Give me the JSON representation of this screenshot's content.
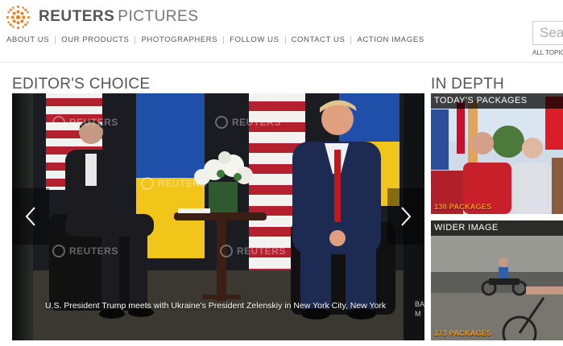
{
  "header": {
    "brand_bold": "REUTERS",
    "brand_light": "PICTURES",
    "logo_icon": "reuters-logo-icon",
    "accent_color": "#f07f1a"
  },
  "nav": {
    "items": [
      {
        "label": "ABOUT US"
      },
      {
        "label": "OUR PRODUCTS"
      },
      {
        "label": "PHOTOGRAPHERS"
      },
      {
        "label": "FOLLOW US"
      },
      {
        "label": "CONTACT US"
      },
      {
        "label": "ACTION IMAGES"
      }
    ]
  },
  "search": {
    "placeholder": "Sea",
    "all_topics": "ALL TOPIC"
  },
  "editors_choice": {
    "title": "EDITOR'S CHOICE",
    "caption": "U.S. President Trump meets with Ukraine's President Zelenskiy in New York City, New York",
    "next_peek_1": "BA",
    "next_peek_2": "M",
    "watermark": "REUTERS",
    "prev_icon": "chevron-left-icon",
    "next_icon": "chevron-right-icon"
  },
  "in_depth": {
    "title": "IN DEPTH",
    "cards": [
      {
        "label": "TODAY'S PACKAGES",
        "count": "130 PACKAGES"
      },
      {
        "label": "WIDER IMAGE",
        "count": "173 PACKAGES"
      }
    ],
    "count_color": "#ff9a1a"
  }
}
